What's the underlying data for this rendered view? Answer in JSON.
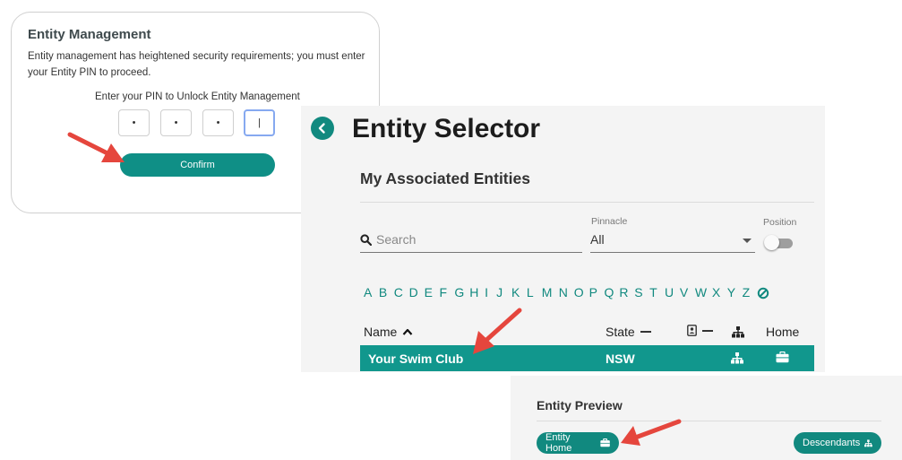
{
  "pin_panel": {
    "title": "Entity Management",
    "description": "Entity management has heightened security requirements; you must enter your Entity PIN to proceed.",
    "prompt": "Enter your PIN to Unlock Entity Management",
    "pin_boxes": [
      "•",
      "•",
      "•",
      "|"
    ],
    "confirm_label": "Confirm"
  },
  "selector": {
    "title": "Entity Selector",
    "subtitle": "My Associated Entities",
    "search_placeholder": "Search",
    "pinnacle_label": "Pinnacle",
    "pinnacle_value": "All",
    "position_label": "Position",
    "alphabet": [
      "A",
      "B",
      "C",
      "D",
      "E",
      "F",
      "G",
      "H",
      "I",
      "J",
      "K",
      "L",
      "M",
      "N",
      "O",
      "P",
      "Q",
      "R",
      "S",
      "T",
      "U",
      "V",
      "W",
      "X",
      "Y",
      "Z"
    ],
    "columns": {
      "name": "Name",
      "state": "State",
      "home": "Home"
    },
    "rows": [
      {
        "name": "Your Swim Club",
        "state": "NSW"
      }
    ]
  },
  "preview": {
    "title": "Entity Preview",
    "entity_home_label": "Entity Home",
    "descendants_label": "Descendants"
  },
  "colors": {
    "accent": "#11897f",
    "row_highlight": "#11978d",
    "arrow": "#e5463d"
  }
}
